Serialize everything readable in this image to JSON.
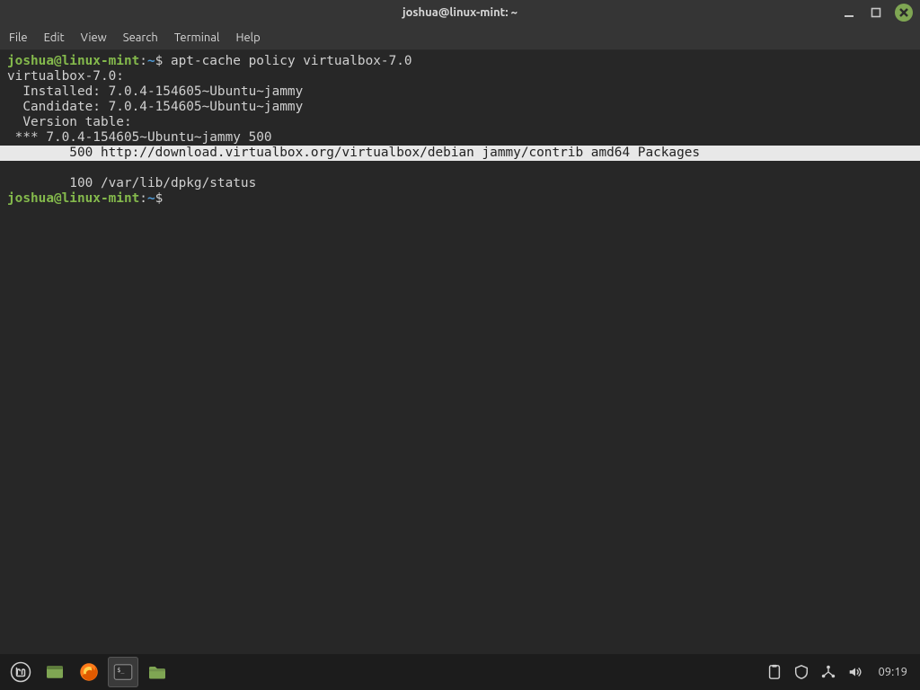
{
  "window": {
    "title": "joshua@linux-mint: ~"
  },
  "menubar": [
    "File",
    "Edit",
    "View",
    "Search",
    "Terminal",
    "Help"
  ],
  "prompt": {
    "user_host": "joshua@linux-mint",
    "sep1": ":",
    "path": "~",
    "sigil": "$"
  },
  "terminal": {
    "cmd1": "apt-cache policy virtualbox-7.0",
    "out_pkg": "virtualbox-7.0:",
    "out_installed": "  Installed: 7.0.4-154605~Ubuntu~jammy",
    "out_candidate": "  Candidate: 7.0.4-154605~Ubuntu~jammy",
    "out_vtable": "  Version table:",
    "out_ver_line": " *** 7.0.4-154605~Ubuntu~jammy 500",
    "out_repo_line": "        500 http://download.virtualbox.org/virtualbox/debian jammy/contrib amd64 Packages",
    "out_status_line": "        100 /var/lib/dpkg/status"
  },
  "taskbar": {
    "clock": "09:19"
  }
}
